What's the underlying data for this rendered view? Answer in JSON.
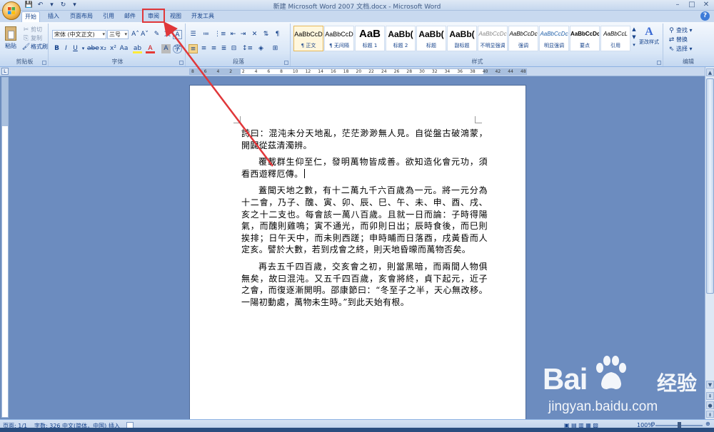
{
  "window": {
    "title": "新建 Microsoft Word 2007 文档.docx - Microsoft Word"
  },
  "tabs": [
    {
      "label": "开始",
      "active": true
    },
    {
      "label": "插入"
    },
    {
      "label": "页面布局"
    },
    {
      "label": "引用"
    },
    {
      "label": "邮件"
    },
    {
      "label": "审阅"
    },
    {
      "label": "视图"
    },
    {
      "label": "开发工具"
    }
  ],
  "ribbon": {
    "clipboard": {
      "paste": "粘贴",
      "cut": "剪切",
      "copy": "复制",
      "format_painter": "格式刷",
      "label": "剪贴板"
    },
    "font": {
      "font_name": "宋体 (中文正文)",
      "font_size": "三号",
      "label": "字体"
    },
    "paragraph": {
      "label": "段落"
    },
    "styles": {
      "tiles": [
        {
          "sample": "AaBbCcD",
          "name": "¶ 正文",
          "selected": true
        },
        {
          "sample": "AaBbCcD",
          "name": "¶ 无间隔"
        },
        {
          "sample": "AaB",
          "name": "标题 1"
        },
        {
          "sample": "AaBb(",
          "name": "标题 2"
        },
        {
          "sample": "AaBb(",
          "name": "标题"
        },
        {
          "sample": "AaBb(",
          "name": "副标题"
        },
        {
          "sample": "AaBbCcDc",
          "name": "不明显强调"
        },
        {
          "sample": "AaBbCcDc",
          "name": "强调"
        },
        {
          "sample": "AaBbCcDc",
          "name": "明显强调"
        },
        {
          "sample": "AaBbCcDc",
          "name": "要点"
        },
        {
          "sample": "AaBbCcL",
          "name": "引用"
        }
      ],
      "change_styles": "更改样式",
      "label": "样式"
    },
    "editing": {
      "find": "查找",
      "replace": "替换",
      "select": "选择",
      "label": "编辑"
    }
  },
  "document": {
    "paragraphs": [
      "詩曰：混沌未分天地亂，茫茫渺渺無人見。自從盤古破鴻蒙，開闢從茲清濁辨。",
      "覆載群生仰至仁，發明萬物皆成善。欲知造化會元功，須看西遊釋厄傳。",
      "蓋聞天地之數，有十二萬九千六百歲為一元。將一元分為十二會，乃子、醜、寅、卯、辰、巳、午、未、申、酉、戌、亥之十二支也。每會該一萬八百歲。且就一日而論：子時得陽氣，而醜則雞鳴；寅不通光，而卯則日出；辰時食後，而巳則挨排；日午天中，而未則西蹉；申時晡而日落酉，戌黃昏而人定亥。譬於大數，若到戌會之終，則天地昏曚而萬物否矣。",
      "再去五千四百歲，交亥會之初，則當黑暗，而兩間人物俱無矣，故曰混沌。又五千四百歲，亥會將終，貞下起元，近子之會，而復逐漸開明。邵康節曰：“冬至子之半，天心無改移。一陽初動處，萬物未生時。”到此天始有根。"
    ]
  },
  "status_bar": {
    "page": "页面: 1/1",
    "words": "字数: 326",
    "language": "中文(简体，中国)",
    "mode": "插入",
    "zoom": "100%",
    "zoom_fraction": 0.5
  },
  "ruler": {
    "ticks": [
      "8",
      "6",
      "4",
      "2",
      "2",
      "4",
      "6",
      "8",
      "10",
      "12",
      "14",
      "16",
      "18",
      "20",
      "22",
      "24",
      "26",
      "28",
      "30",
      "32",
      "34",
      "36",
      "38",
      "40",
      "42",
      "44",
      "48"
    ]
  },
  "watermark": {
    "brand": "Bai",
    "brand_cn": "经验",
    "url": "jingyan.baidu.com"
  },
  "colors": {
    "annotation": "#e0373a",
    "ribbon_bg": "#dbe7f7",
    "doc_bg": "#6c8cbf"
  }
}
